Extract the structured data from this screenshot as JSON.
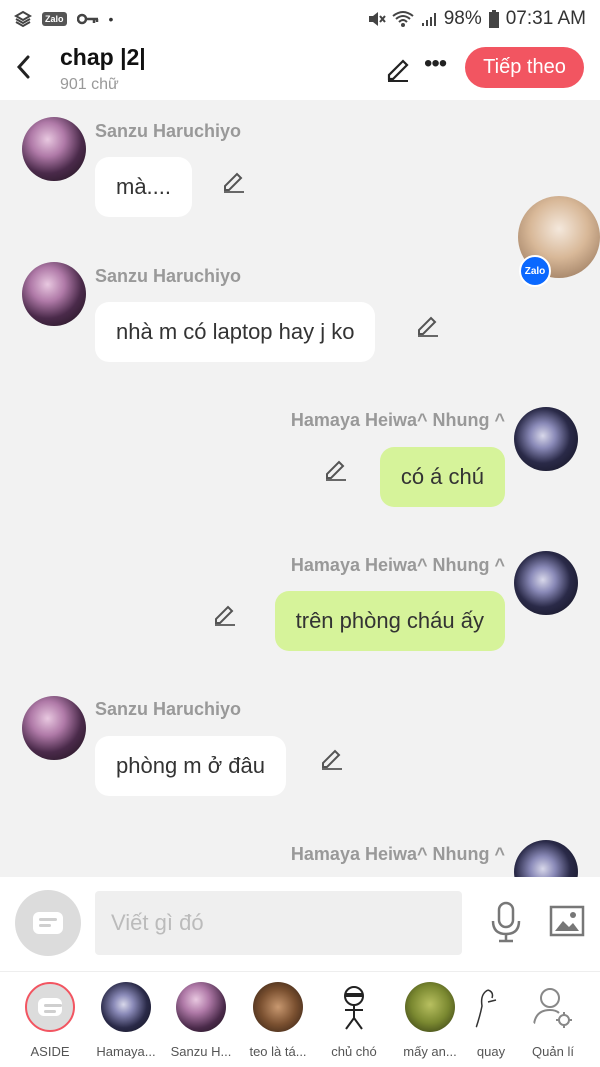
{
  "status_bar": {
    "battery": "98%",
    "time": "07:31 AM",
    "zalo_badge": "Zalo"
  },
  "header": {
    "title": "chap |2|",
    "subtitle": "901 chữ",
    "next_button": "Tiếp theo"
  },
  "messages": [
    {
      "sender": "Sanzu Haruchiyo",
      "text": "mà....",
      "side": "left"
    },
    {
      "sender": "Sanzu Haruchiyo",
      "text": "nhà m có laptop hay j ko",
      "side": "left"
    },
    {
      "sender": "Hamaya Heiwa^ Nhung ^",
      "text": "có á chú",
      "side": "right"
    },
    {
      "sender": "Hamaya Heiwa^ Nhung ^",
      "text": "trên phòng cháu ấy",
      "side": "right"
    },
    {
      "sender": "Sanzu Haruchiyo",
      "text": "phòng m ở đâu",
      "side": "left"
    },
    {
      "sender": "Hamaya Heiwa^ Nhung ^",
      "text": "",
      "side": "right"
    }
  ],
  "floating_head": {
    "badge": "Zalo"
  },
  "composer": {
    "placeholder": "Viết gì đó"
  },
  "characters": [
    {
      "label": "ASIDE",
      "icon": "aside-chat-icon"
    },
    {
      "label": "Hamaya...",
      "icon": "hamaya-avatar"
    },
    {
      "label": "Sanzu H...",
      "icon": "sanzu-avatar"
    },
    {
      "label": "teo là tá...",
      "icon": "teo-avatar"
    },
    {
      "label": "chủ chó",
      "icon": "chu-cho-avatar"
    },
    {
      "label": "mấy an...",
      "icon": "may-an-avatar"
    },
    {
      "label": "quay",
      "icon": "quay-avatar"
    },
    {
      "label": "Quản lí",
      "icon": "manage-characters-icon"
    }
  ],
  "colors": {
    "accent": "#f25561",
    "right_bubble": "#d6f39a",
    "left_bubble": "#ffffff"
  }
}
